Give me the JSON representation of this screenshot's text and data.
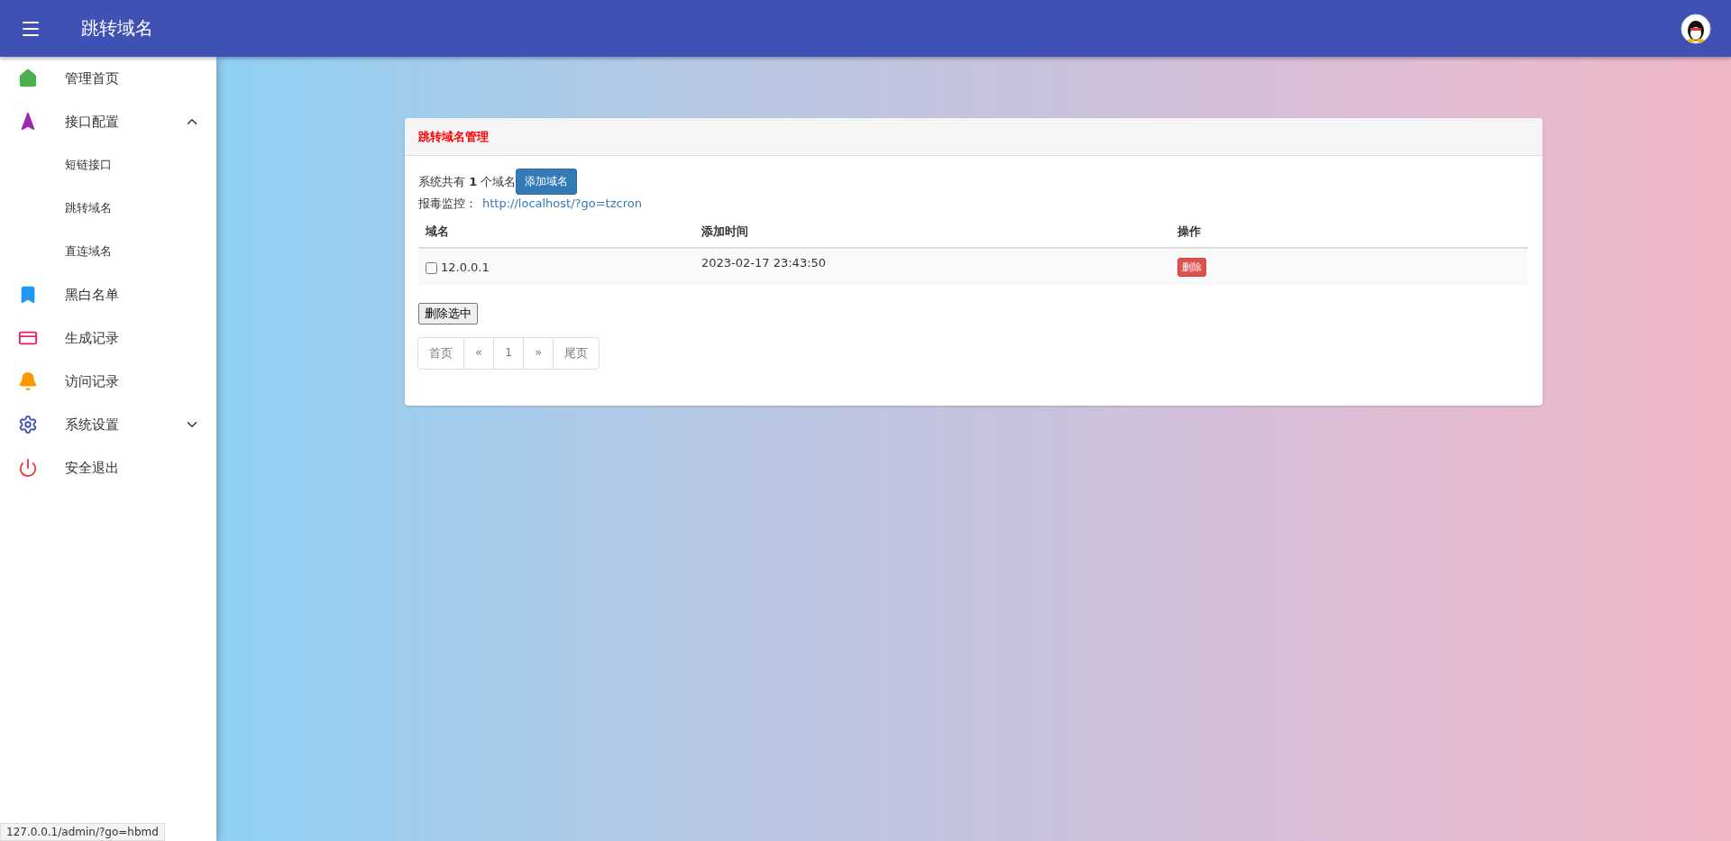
{
  "app_bar": {
    "title": "跳转域名"
  },
  "sidebar": {
    "items": [
      {
        "label": "管理首页"
      },
      {
        "label": "接口配置",
        "expanded": true,
        "children": [
          {
            "label": "短链接口"
          },
          {
            "label": "跳转域名"
          },
          {
            "label": "直连域名"
          }
        ]
      },
      {
        "label": "黑白名单"
      },
      {
        "label": "生成记录"
      },
      {
        "label": "访问记录"
      },
      {
        "label": "系统设置",
        "expanded": false
      },
      {
        "label": "安全退出"
      }
    ]
  },
  "panel": {
    "title": "跳转域名管理",
    "summary_prefix": "系统共有 **1** 个域名",
    "add_button": "添加域名",
    "monitor_label": "报毒监控：",
    "monitor_link": "http://localhost/?go=tzcron",
    "table": {
      "columns": [
        "域名",
        "添加时间",
        "操作"
      ],
      "rows": [
        {
          "domain": "12.0.0.1",
          "checked": false,
          "added": "2023-02-17 23:43:50",
          "action": "删除"
        }
      ]
    },
    "delete_selected": "删除选中",
    "pagination": [
      "首页",
      "«",
      "1",
      "»",
      "尾页"
    ]
  },
  "status_bar": "127.0.0.1/admin/?go=hbmd"
}
